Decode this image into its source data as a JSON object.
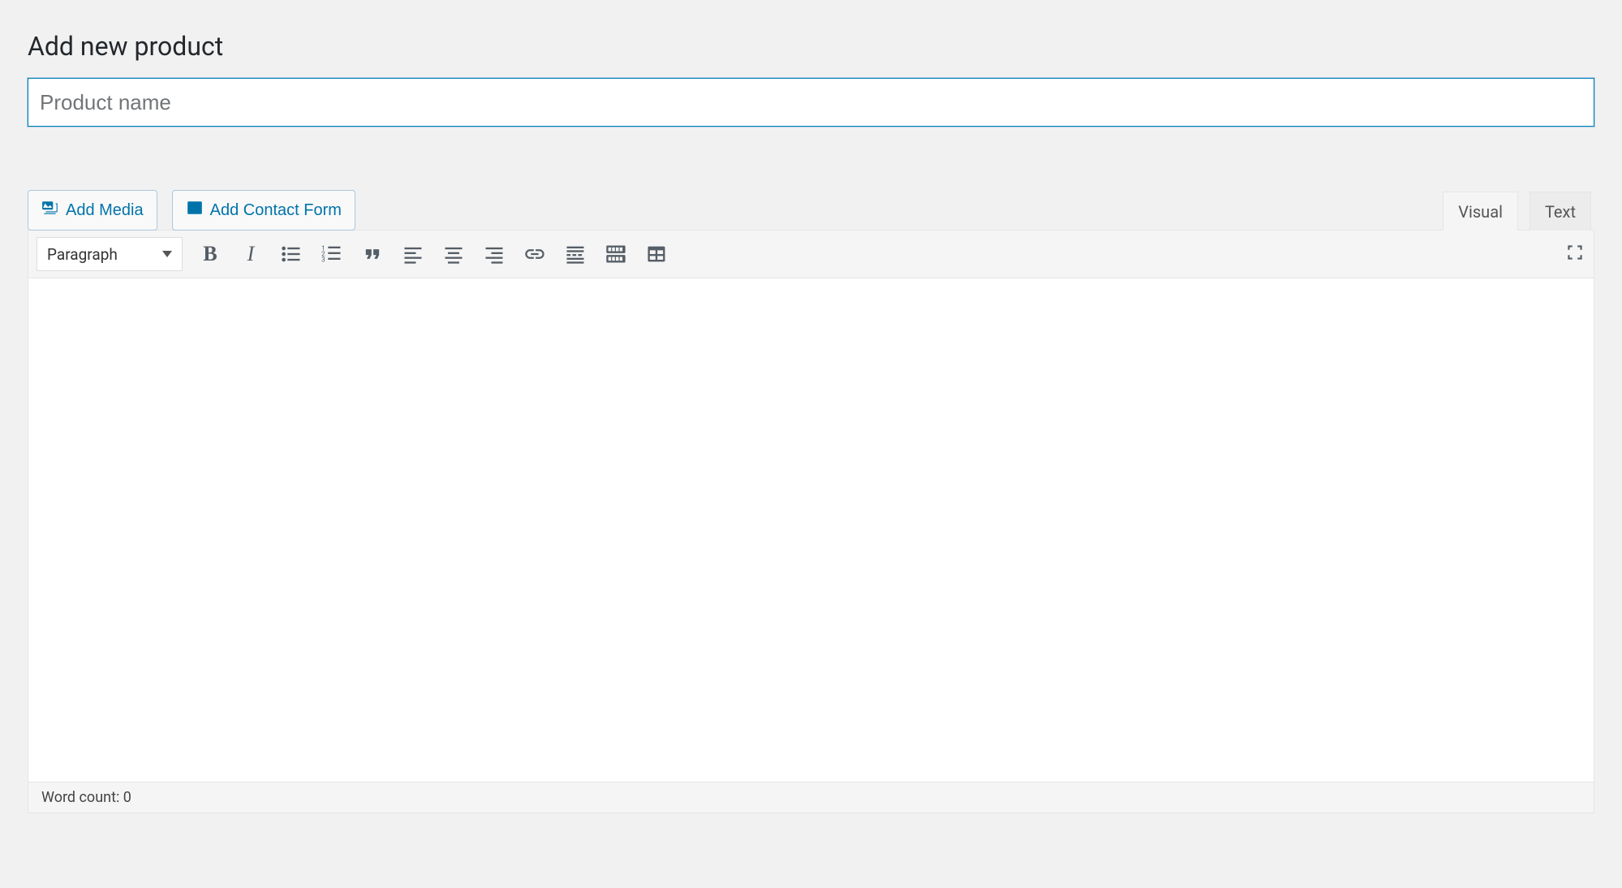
{
  "page": {
    "title": "Add new product"
  },
  "title_input": {
    "placeholder": "Product name",
    "value": ""
  },
  "media_buttons": {
    "add_media": "Add Media",
    "add_contact_form": "Add Contact Form"
  },
  "tabs": {
    "visual": "Visual",
    "text": "Text",
    "active": "visual"
  },
  "toolbar": {
    "format_select": "Paragraph",
    "icons": {
      "bold": "bold",
      "italic": "italic",
      "ul": "bulleted-list",
      "ol": "numbered-list",
      "blockquote": "blockquote",
      "align_left": "align-left",
      "align_center": "align-center",
      "align_right": "align-right",
      "link": "insert-link",
      "more": "insert-read-more",
      "toolbar_toggle": "toolbar-toggle",
      "table": "table",
      "fullscreen": "fullscreen"
    }
  },
  "editor": {
    "content": ""
  },
  "status": {
    "word_count_label": "Word count: ",
    "word_count": "0"
  },
  "colors": {
    "accent": "#0073aa"
  }
}
